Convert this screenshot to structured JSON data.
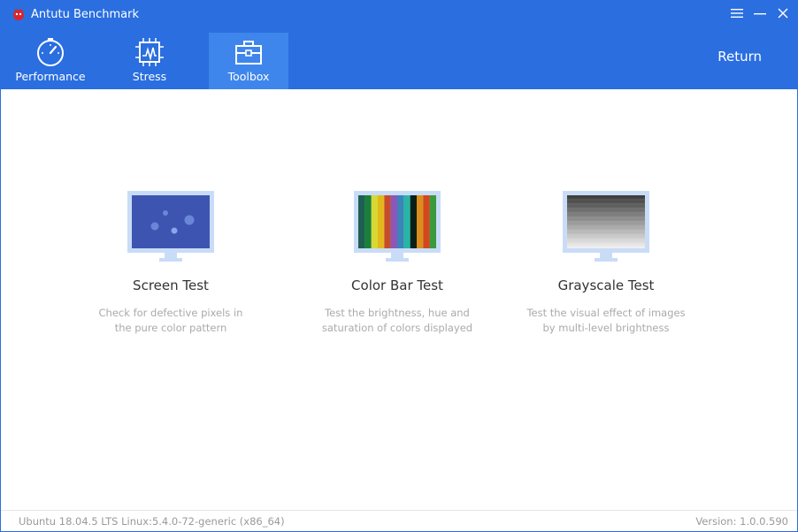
{
  "window": {
    "title": "Antutu Benchmark",
    "icons": [
      "antutu-logo-icon",
      "menu-icon",
      "minimize-icon",
      "close-icon"
    ]
  },
  "nav": {
    "tabs": [
      {
        "label": "Performance",
        "icon": "speedometer-icon",
        "active": false
      },
      {
        "label": "Stress",
        "icon": "chip-icon",
        "active": false
      },
      {
        "label": "Toolbox",
        "icon": "toolbox-icon",
        "active": true
      }
    ],
    "return_label": "Return"
  },
  "tools": [
    {
      "title": "Screen Test",
      "desc_line1": "Check for defective pixels in",
      "desc_line2": "the pure color pattern",
      "icon": "screen-test-monitor-icon"
    },
    {
      "title": "Color Bar Test",
      "desc_line1": "Test the brightness, hue and",
      "desc_line2": "saturation of colors displayed",
      "icon": "color-bar-monitor-icon"
    },
    {
      "title": "Grayscale Test",
      "desc_line1": "Test the visual effect of images",
      "desc_line2": "by multi-level brightness",
      "icon": "grayscale-monitor-icon"
    }
  ],
  "footer": {
    "os": "Ubuntu 18.04.5 LTS  Linux:5.4.0-72-generic (x86_64)",
    "version": "Version: 1.0.0.590"
  },
  "colors": {
    "accent": "#2a6ee0",
    "active_tab": "#3f86ec",
    "screen_blue": "#3d55b0",
    "monitor_frame": "#c9dcf7"
  }
}
